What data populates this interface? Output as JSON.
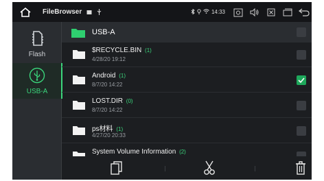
{
  "statusbar": {
    "app_title": "FileBrowser",
    "time": "14:33",
    "icons": [
      "home-icon",
      "image-icon",
      "usb-small-icon",
      "bluetooth-icon",
      "location-icon",
      "wifi-icon",
      "screenshot-icon",
      "volume-icon",
      "close-box-icon",
      "window-icon",
      "back-icon"
    ]
  },
  "sidebar": {
    "items": [
      {
        "label": "Flash",
        "icon": "sd-card-icon",
        "selected": false
      },
      {
        "label": "USB-A",
        "icon": "usb-icon",
        "selected": true
      }
    ]
  },
  "list": {
    "header": {
      "title": "USB-A",
      "checked": false
    },
    "rows": [
      {
        "name": "$RECYCLE.BIN",
        "count": "(1)",
        "date": "4/28/20 19:12",
        "checked": false
      },
      {
        "name": "Android",
        "count": "(1)",
        "date": "8/7/20 14:22",
        "checked": true
      },
      {
        "name": "LOST.DIR",
        "count": "(0)",
        "date": "8/7/20 14:22",
        "checked": false
      },
      {
        "name": "ps材料",
        "count": "(1)",
        "date": "4/27/20 20:33",
        "checked": false
      },
      {
        "name": "System Volume Information",
        "count": "(2)",
        "date": "",
        "checked": false
      }
    ]
  },
  "toolbar": {
    "buttons": [
      "copy-icon",
      "cut-icon",
      "delete-icon"
    ]
  },
  "colors": {
    "accent": "#3bd67c",
    "check": "#1ea85b",
    "background": "#1c1e21",
    "panel": "#2a2d31"
  }
}
